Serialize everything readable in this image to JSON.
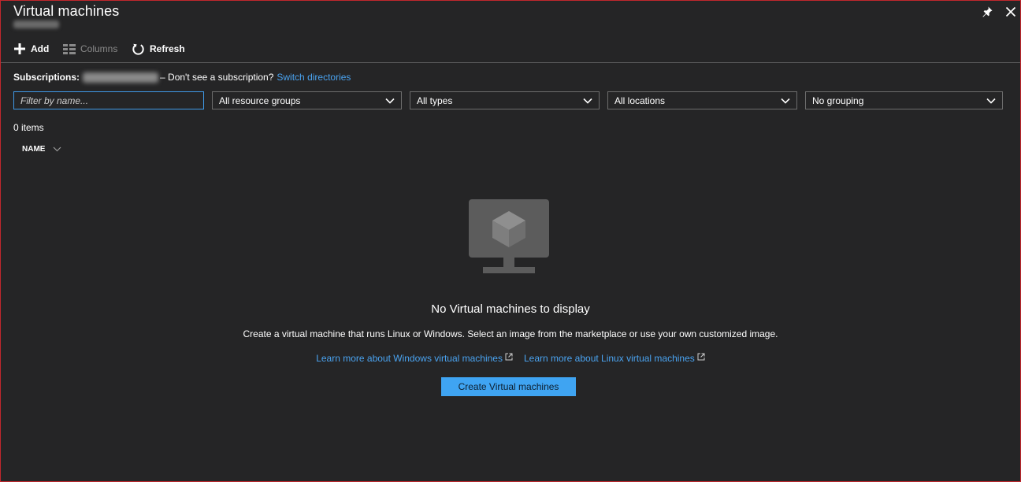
{
  "header": {
    "title": "Virtual machines",
    "pin_icon": "pin-icon",
    "close_icon": "close-icon"
  },
  "toolbar": {
    "add_label": "Add",
    "columns_label": "Columns",
    "refresh_label": "Refresh"
  },
  "subscriptions": {
    "label": "Subscriptions:",
    "question": "– Don't see a subscription?",
    "switch_link": "Switch directories"
  },
  "filters": {
    "name_placeholder": "Filter by name...",
    "resource_groups": "All resource groups",
    "types": "All types",
    "locations": "All locations",
    "grouping": "No grouping"
  },
  "list": {
    "item_count": "0 items",
    "column_name": "NAME"
  },
  "empty_state": {
    "icon": "virtual-machine-monitor-icon",
    "title": "No Virtual machines to display",
    "description": "Create a virtual machine that runs Linux or Windows. Select an image from the marketplace or use your own customized image.",
    "link_windows": "Learn more about Windows virtual machines",
    "link_linux": "Learn more about Linux virtual machines",
    "create_button": "Create Virtual machines"
  },
  "colors": {
    "background": "#252526",
    "accent_link": "#4aa3f0",
    "primary_button": "#3fa4f2",
    "frame_border": "#c1272d"
  }
}
